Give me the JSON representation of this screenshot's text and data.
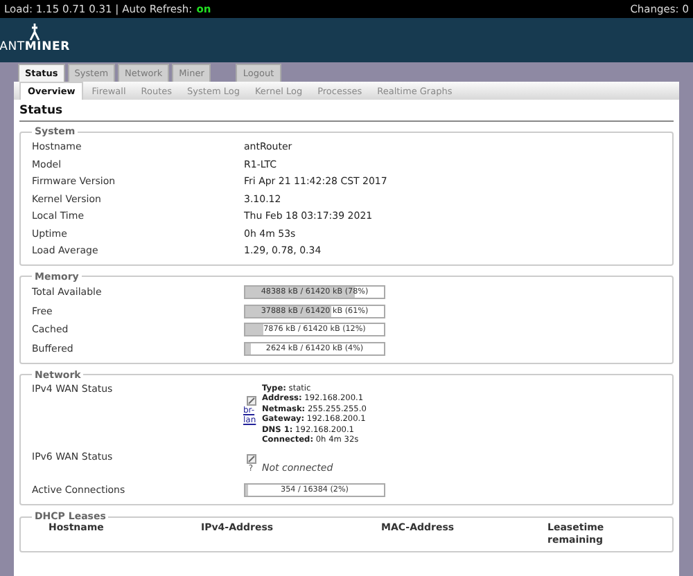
{
  "top_bar": {
    "load": "Load: 1.15 0.71 0.31 | Auto Refresh:",
    "auto_refresh": "on",
    "changes": "Changes: 0"
  },
  "logo": {
    "light": "ANT",
    "bold": "MINER"
  },
  "tabs": [
    {
      "label": "Status",
      "selected": true
    },
    {
      "label": "System",
      "selected": false
    },
    {
      "label": "Network",
      "selected": false
    },
    {
      "label": "Miner",
      "selected": false
    }
  ],
  "logout_tab": {
    "label": "Logout"
  },
  "subtabs": [
    {
      "label": "Overview",
      "selected": true
    },
    {
      "label": "Firewall",
      "selected": false
    },
    {
      "label": "Routes",
      "selected": false
    },
    {
      "label": "System Log",
      "selected": false
    },
    {
      "label": "Kernel Log",
      "selected": false
    },
    {
      "label": "Processes",
      "selected": false
    },
    {
      "label": "Realtime Graphs",
      "selected": false
    }
  ],
  "page_title": "Status",
  "system": {
    "legend": "System",
    "rows": [
      {
        "label": "Hostname",
        "value": "antRouter"
      },
      {
        "label": "Model",
        "value": "R1-LTC"
      },
      {
        "label": "Firmware Version",
        "value": "Fri Apr 21 11:42:28 CST 2017"
      },
      {
        "label": "Kernel Version",
        "value": "3.10.12"
      },
      {
        "label": "Local Time",
        "value": "Thu Feb 18 03:17:39 2021"
      },
      {
        "label": "Uptime",
        "value": "0h 4m 53s"
      },
      {
        "label": "Load Average",
        "value": "1.29, 0.78, 0.34"
      }
    ]
  },
  "memory": {
    "legend": "Memory",
    "rows": [
      {
        "label": "Total Available",
        "reading": "48388 kB / 61420 kB (78%)",
        "level": 0.788
      },
      {
        "label": "Free",
        "reading": "37888 kB / 61420 kB (61%)",
        "level": 0.617
      },
      {
        "label": "Cached",
        "reading": "7876 kB / 61420 kB (12%)",
        "level": 0.128
      },
      {
        "label": "Buffered",
        "reading": "2624 kB / 61420 kB (4%)",
        "level": 0.043
      }
    ]
  },
  "network": {
    "legend": "Network",
    "ipv4": {
      "label": "IPv4 WAN Status",
      "interface": "br-lan",
      "details": [
        "**Type:** static",
        "**Address:** 192.168.200.1",
        "**Netmask:** 255.255.255.0",
        "**Gateway:** 192.168.200.1",
        "**DNS 1:** 192.168.200.1",
        "**Connected:** 0h 4m 32s"
      ]
    },
    "ipv6": {
      "label": "IPv6 WAN Status",
      "interface": "?",
      "status": "Not connected"
    },
    "active_connections": {
      "label": "Active Connections",
      "reading": "354 / 16384 (2%)",
      "level": 0.022
    }
  },
  "dhcp_leases": {
    "legend": "DHCP Leases",
    "columns": [
      "Hostname",
      "IPv4-Address",
      "MAC-Address",
      "Leasetime remaining"
    ]
  }
}
